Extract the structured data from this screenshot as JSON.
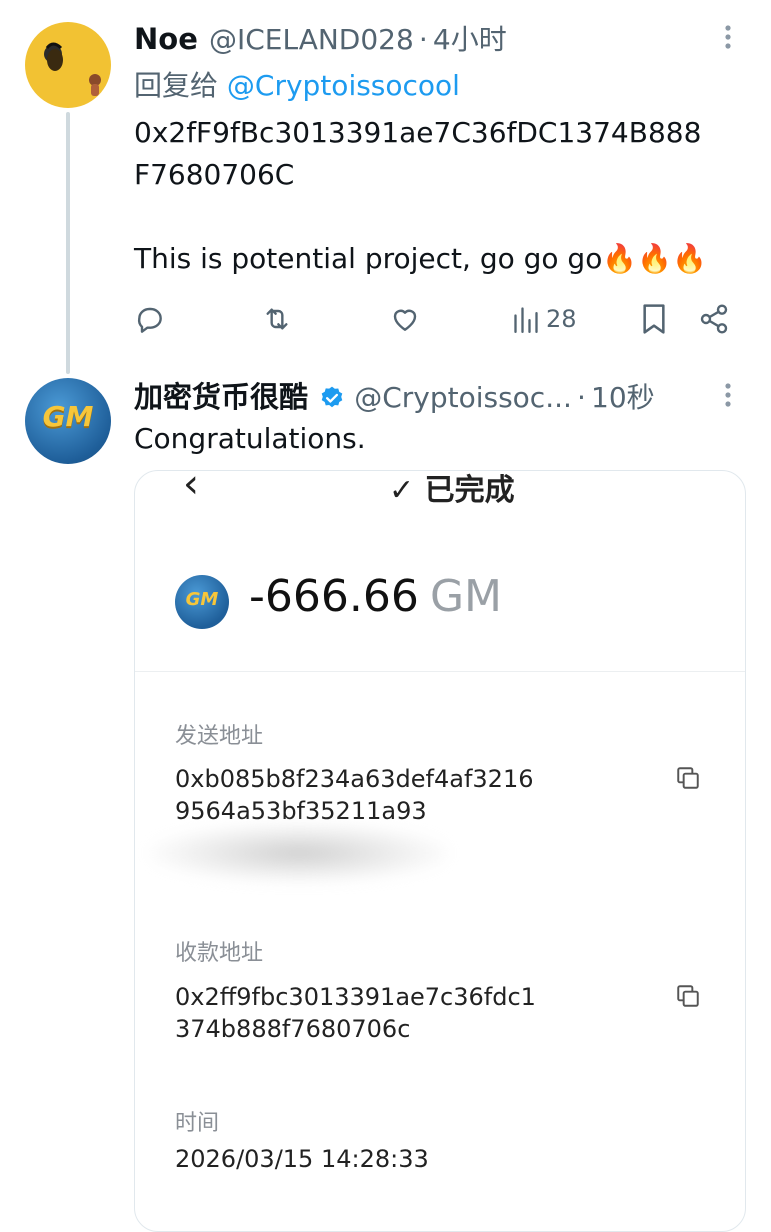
{
  "tweet1": {
    "name": "Noe",
    "handle": "@ICELAND028",
    "separator": "·",
    "time": "4小时",
    "reply_prefix": "回复给",
    "reply_to": "@Cryptoissocool",
    "address_line1": "0x2fF9fBc3013391ae7C36fDC1374B888",
    "address_line2": "F7680706C",
    "message": "This is potential project, go go go🔥🔥🔥",
    "actions": {
      "views_count": "28"
    }
  },
  "tweet2": {
    "name": "加密货币很酷",
    "handle": "@Cryptoissoc...",
    "separator": "·",
    "time": "10秒",
    "text": "Congratulations.",
    "avatar_text": "GM"
  },
  "card": {
    "back_glyph": "‹",
    "status": "✓ 已完成",
    "token_icon_text": "GM",
    "amount": "-666.66",
    "token": "GM",
    "send_label": "发送地址",
    "send_address_line1": "0xb085b8f234a63def4af3216",
    "send_address_line2": "9564a53bf35211a93",
    "receive_label": "收款地址",
    "receive_address_line1": "0x2ff9fbc3013391ae7c36fdc1",
    "receive_address_line2": "374b888f7680706c",
    "time_label": "时间",
    "time_value": "2026/03/15 14:28:33"
  },
  "colors": {
    "link_blue": "#1d9bf0",
    "muted_gray": "#536471",
    "avatar1_bg": "#f2c233",
    "avatar2_bg": "#1f5f9a"
  }
}
